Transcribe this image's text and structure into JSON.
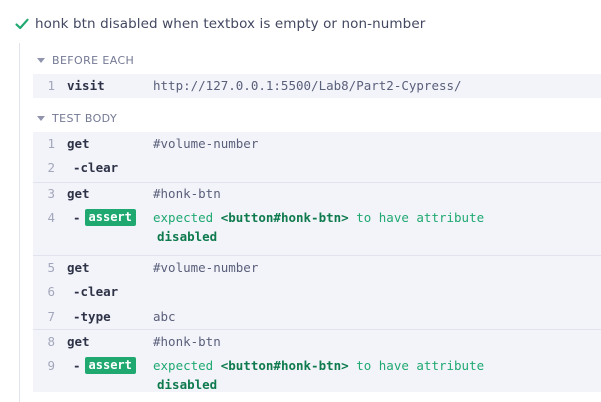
{
  "test": {
    "title": "honk btn disabled when textbox is empty or non-number",
    "status_icon": "check-icon",
    "status_color": "#1fa971"
  },
  "before_each": {
    "header": "BEFORE EACH",
    "commands": [
      {
        "num": "1",
        "cmd": "visit",
        "msg": "http://127.0.0.1:5500/Lab8/Part2-Cypress/"
      }
    ]
  },
  "test_body": {
    "header": "TEST BODY",
    "commands": [
      {
        "num": "1",
        "cmd": "get",
        "msg": "#volume-number"
      },
      {
        "num": "2",
        "cmd": "-clear",
        "msg": ""
      },
      {
        "num": "3",
        "cmd": "get",
        "msg": "#honk-btn"
      },
      {
        "num": "4",
        "cmd": "-",
        "badge": "assert",
        "msg_prefix": "expected ",
        "msg_strong": "<button#honk-btn>",
        "msg_suffix": " to have attribute",
        "msg_line2": "disabled"
      },
      {
        "num": "5",
        "cmd": "get",
        "msg": "#volume-number"
      },
      {
        "num": "6",
        "cmd": "-clear",
        "msg": ""
      },
      {
        "num": "7",
        "cmd": "-type",
        "msg": "abc"
      },
      {
        "num": "8",
        "cmd": "get",
        "msg": "#honk-btn"
      },
      {
        "num": "9",
        "cmd": "-",
        "badge": "assert",
        "msg_prefix": "expected ",
        "msg_strong": "<button#honk-btn>",
        "msg_suffix": " to have attribute",
        "msg_line2": "disabled"
      }
    ]
  },
  "colors": {
    "accent_green": "#1fa971",
    "row_background": "#f3f4fa",
    "text_dark": "#2e3247"
  }
}
